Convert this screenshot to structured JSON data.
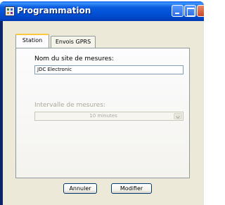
{
  "window": {
    "title": "Programmation",
    "controls": [
      "minimize-icon",
      "maximize-icon",
      "close-icon"
    ]
  },
  "tabs": [
    {
      "label": "Station",
      "active": true
    },
    {
      "label": "Envois GPRS",
      "active": false
    }
  ],
  "station": {
    "site_label": "Nom du site de mesures:",
    "site_value": "JDC Electronic",
    "interval_label": "Intervalle de mesures:",
    "interval_value": "10 minutes",
    "interval_enabled": false
  },
  "buttons": {
    "cancel_label": "Annuler",
    "modify_label": "Modifier"
  },
  "colors": {
    "titlebar": "#0251d5",
    "dialog_bg": "#ece9d8",
    "active_tab_highlight": "#ffc83c"
  }
}
